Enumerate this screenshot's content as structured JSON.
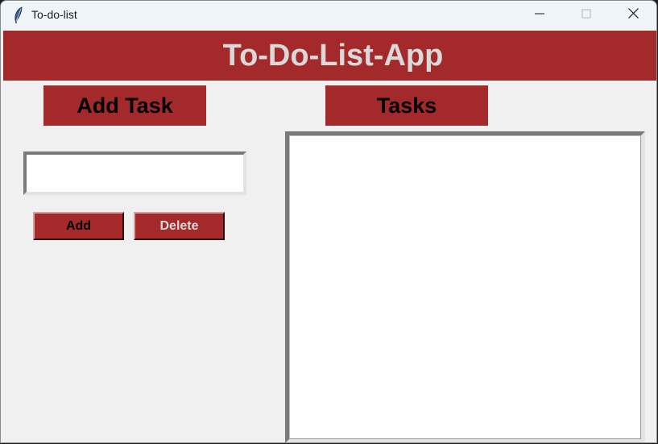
{
  "window": {
    "title": "To-do-list",
    "icons": {
      "app": "feather-icon",
      "minimize": "minimize-icon",
      "maximize": "maximize-icon",
      "close": "close-icon"
    }
  },
  "header": {
    "title": "To-Do-List-App"
  },
  "labels": {
    "add_task": "Add Task",
    "tasks": "Tasks"
  },
  "task_input": {
    "value": "",
    "placeholder": ""
  },
  "buttons": {
    "add": "Add",
    "delete": "Delete"
  },
  "tasks_list": {
    "items": []
  },
  "colors": {
    "accent": "#a3292a",
    "header_text": "#d9d9d9",
    "background": "#f0f0f0"
  }
}
